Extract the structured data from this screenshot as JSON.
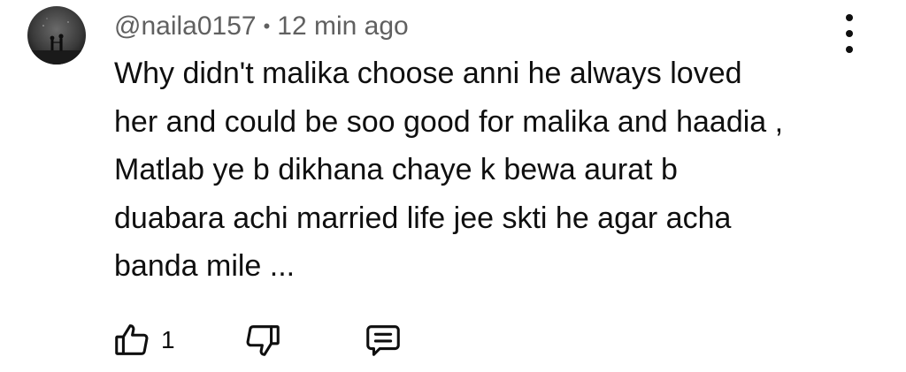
{
  "comment": {
    "author": "@naila0157",
    "separator": "•",
    "timestamp": "12 min ago",
    "text_lines": [
      "Why didn't malika choose anni he always loved",
      "her and could be soo good for malika and haadia ,",
      "Matlab ye b dikhana chaye k bewa aurat b",
      "duabara achi married life jee skti he agar acha",
      "banda mile ..."
    ],
    "like_count": "1",
    "icons": {
      "avatar": "avatar-silhouette-couple",
      "menu": "more-vert-icon",
      "like": "thumbs-up-icon",
      "dislike": "thumbs-down-icon",
      "reply": "comment-reply-icon"
    },
    "colors": {
      "text": "#0f0f0f",
      "meta": "#606060",
      "background": "#ffffff"
    }
  }
}
